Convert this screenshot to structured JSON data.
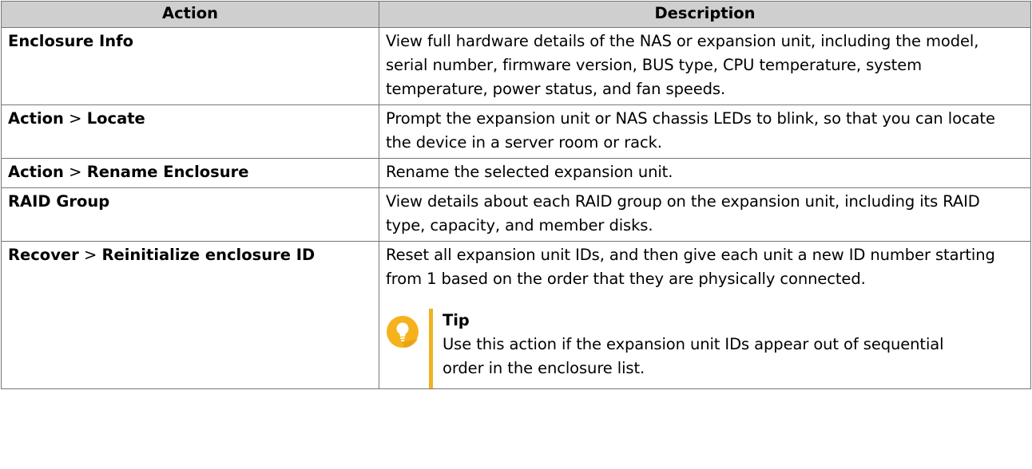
{
  "header": {
    "action": "Action",
    "description": "Description"
  },
  "rows": [
    {
      "action_main": "Enclosure Info",
      "action_sep": "",
      "action_sub": "",
      "description": "View full hardware details of the NAS or expansion unit, including the model, serial number, firmware version, BUS type, CPU temperature, system temperature, power status, and fan speeds."
    },
    {
      "action_main": "Action",
      "action_sep": " > ",
      "action_sub": "Locate",
      "description": "Prompt the expansion unit or NAS chassis LEDs to blink, so that you can locate the device in a server room or rack."
    },
    {
      "action_main": "Action",
      "action_sep": " > ",
      "action_sub": "Rename Enclosure",
      "description": "Rename the selected expansion unit."
    },
    {
      "action_main": "RAID Group",
      "action_sep": "",
      "action_sub": "",
      "description": "View details about each RAID group on the expansion unit, including its RAID type, capacity, and member disks."
    },
    {
      "action_main": "Recover",
      "action_sep": " > ",
      "action_sub": "Reinitialize enclosure ID",
      "description": "Reset all expansion unit IDs, and then give each unit a new ID number starting from 1 based on the order that they are physically connected.",
      "tip": {
        "icon": "lightbulb-icon",
        "title": "Tip",
        "text": "Use this action if the expansion unit IDs appear out of sequential order in the enclosure list."
      }
    }
  ],
  "colors": {
    "header_bg": "#cfcfcf",
    "border": "#777777",
    "tip_accent": "#f0b320",
    "tip_icon_bg": "#f5b21c"
  }
}
